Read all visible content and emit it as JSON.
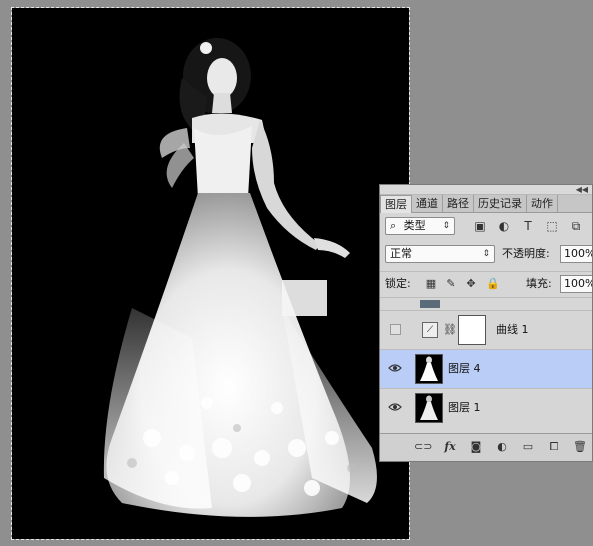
{
  "panel": {
    "tabs": [
      "图层",
      "通道",
      "路径",
      "历史记录",
      "动作"
    ],
    "filter": {
      "label": "类型",
      "search_icon": "search-icon"
    },
    "filter_icons": [
      "image-filter-icon",
      "adjustment-filter-icon",
      "type-filter-icon",
      "shape-filter-icon",
      "smart-object-filter-icon"
    ],
    "blend_mode": "正常",
    "opacity_label": "不透明度:",
    "opacity_value": "100%",
    "lock_label": "锁定:",
    "fill_label": "填充:",
    "fill_value": "100%",
    "layers": [
      {
        "name": "曲线 1",
        "visible": false,
        "selected": false,
        "kind": "adjustment"
      },
      {
        "name": "图层 4",
        "visible": true,
        "selected": true,
        "kind": "pixel"
      },
      {
        "name": "图层 1",
        "visible": true,
        "selected": false,
        "kind": "pixel"
      }
    ],
    "bottom_icons": [
      "link-icon",
      "fx-icon",
      "mask-icon",
      "adjustment-icon",
      "folder-icon",
      "new-layer-icon",
      "trash-icon"
    ],
    "fx_label": "fx"
  },
  "colors": {
    "selected_row": "#b9cdf6",
    "panel_bg": "#d6d6d6",
    "workspace": "#8f8f8f"
  }
}
